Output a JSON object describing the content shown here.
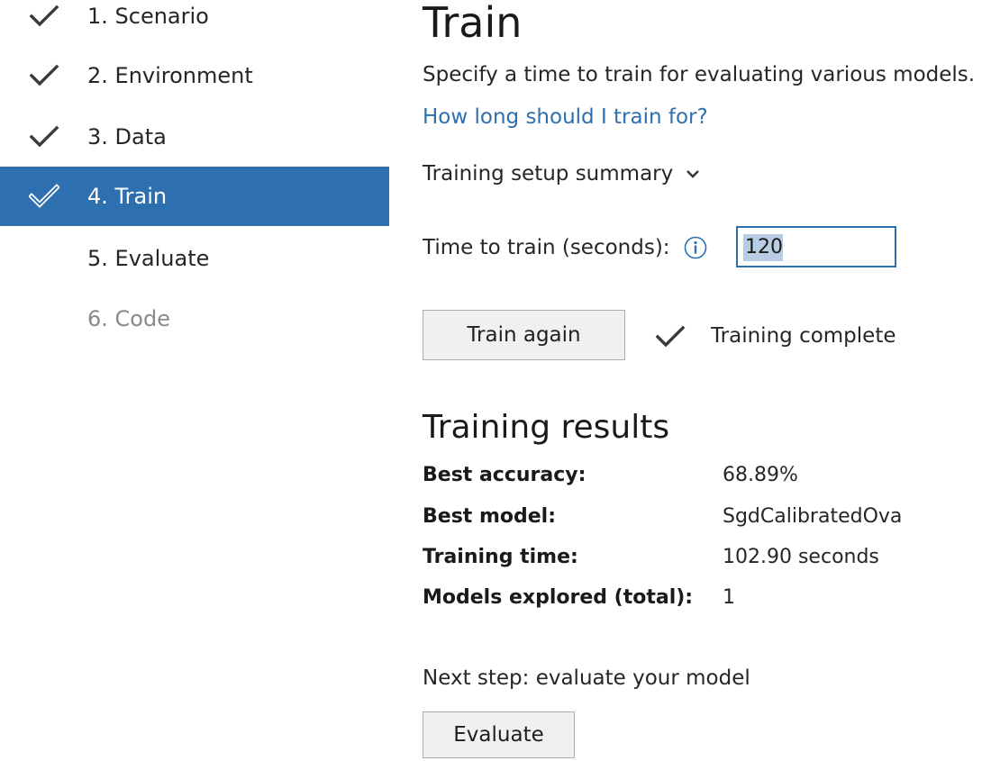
{
  "sidebar": {
    "steps": [
      {
        "label": "1. Scenario",
        "state": "done"
      },
      {
        "label": "2. Environment",
        "state": "done"
      },
      {
        "label": "3. Data",
        "state": "done"
      },
      {
        "label": "4. Train",
        "state": "active"
      },
      {
        "label": "5. Evaluate",
        "state": "pending"
      },
      {
        "label": "6. Code",
        "state": "disabled"
      }
    ]
  },
  "main": {
    "title": "Train",
    "subtitle": "Specify a time to train for evaluating various models.",
    "help_link": "How long should I train for?",
    "summary_label": "Training setup summary",
    "time_label": "Time to train (seconds):",
    "time_value": "120",
    "train_button": "Train again",
    "status_text": "Training complete",
    "results_title": "Training results",
    "results": [
      {
        "key": "Best accuracy:",
        "value": "68.89%"
      },
      {
        "key": "Best model:",
        "value": "SgdCalibratedOva"
      },
      {
        "key": "Training time:",
        "value": "102.90 seconds"
      },
      {
        "key": "Models explored (total):",
        "value": "1"
      }
    ],
    "next_step": "Next step: evaluate your model",
    "evaluate_button": "Evaluate"
  },
  "icons": {
    "step_done": "checkmark-icon",
    "step_active": "checkmark-outline-icon",
    "summary": "chevron-down-icon",
    "info": "info-icon",
    "status": "checkmark-icon"
  },
  "colors": {
    "accent": "#2e6fb0",
    "active_step_bg": "#2e6fb0",
    "disabled_text": "#8a8a8a",
    "selection": "#b8cce4"
  }
}
